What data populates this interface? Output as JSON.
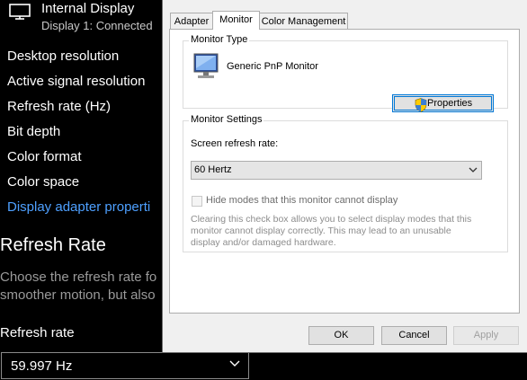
{
  "settings": {
    "display": {
      "title": "Internal Display",
      "subtitle": "Display 1: Connected"
    },
    "info_rows": [
      "Desktop resolution",
      "Active signal resolution",
      "Refresh rate (Hz)",
      "Bit depth",
      "Color format",
      "Color space"
    ],
    "adapter_link": "Display adapter properti",
    "refresh_section": {
      "title": "Refresh Rate",
      "desc_line1": "Choose the refresh rate fo",
      "desc_line2": "smoother motion, but also"
    },
    "refresh_rate_label": "Refresh rate",
    "refresh_rate_value": "59.997 Hz"
  },
  "dialog": {
    "tabs": [
      "Adapter",
      "Monitor",
      "Color Management"
    ],
    "active_tab": "Monitor",
    "monitor_type": {
      "label": "Monitor Type",
      "name": "Generic PnP Monitor",
      "properties_button": "Properties"
    },
    "monitor_settings": {
      "label": "Monitor Settings",
      "refresh_label": "Screen refresh rate:",
      "refresh_value": "60 Hertz",
      "hide_modes_label": "Hide modes that this monitor cannot display",
      "hide_modes_checked": false,
      "note_line1": "Clearing this check box allows you to select display modes that this",
      "note_line2": "monitor cannot display correctly. This may lead to an unusable",
      "note_line3": "display and/or damaged hardware."
    },
    "buttons": {
      "ok": "OK",
      "cancel": "Cancel",
      "apply": "Apply"
    }
  }
}
